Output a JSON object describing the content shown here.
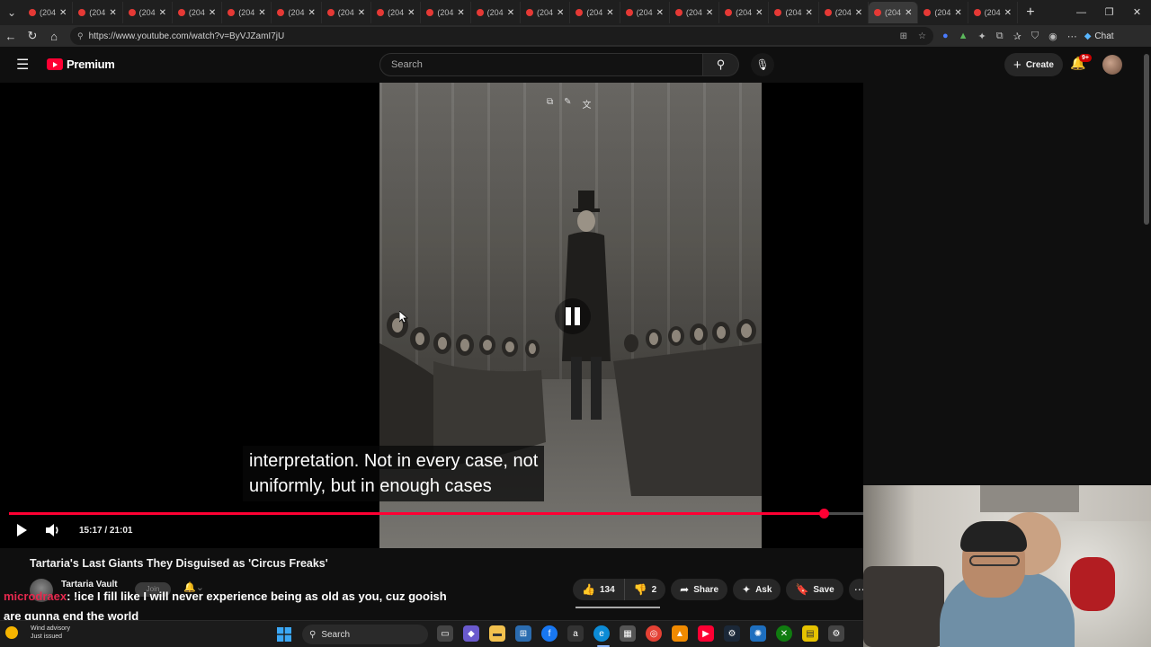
{
  "browser": {
    "tab_label": "(204",
    "tab_count": 20,
    "active_tab_index": 17,
    "url": "https://www.youtube.com/watch?v=ByVJZamI7jU",
    "chat_label": "Chat"
  },
  "masthead": {
    "brand": "Premium",
    "search_placeholder": "Search",
    "create_label": "Create",
    "notification_badge": "9+"
  },
  "player": {
    "caption_line_1": "interpretation. Not in every case, not",
    "caption_line_2": "uniformly, but in enough cases",
    "time": "15:17 / 21:01",
    "progress": 0.9535
  },
  "video": {
    "title": "Tartaria's Last Giants They Disguised as 'Circus Freaks'",
    "channel": "Tartaria Vault",
    "join_label": "Join",
    "likes": "134",
    "dislikes": "2",
    "share_label": "Share",
    "ask_label": "Ask",
    "save_label": "Save"
  },
  "chat_overlay": {
    "username": "microdraex",
    "message_line_1": ": !ice I fill like I will never experience being as old as you, cuz gooish",
    "message_line_2": "are gunna end the world"
  },
  "taskbar": {
    "weather_title": "Wind advisory",
    "weather_sub": "Just issued",
    "search_label": "Search"
  },
  "colors": {
    "accent_red": "#ff0033",
    "background": "#0f0f0f"
  }
}
